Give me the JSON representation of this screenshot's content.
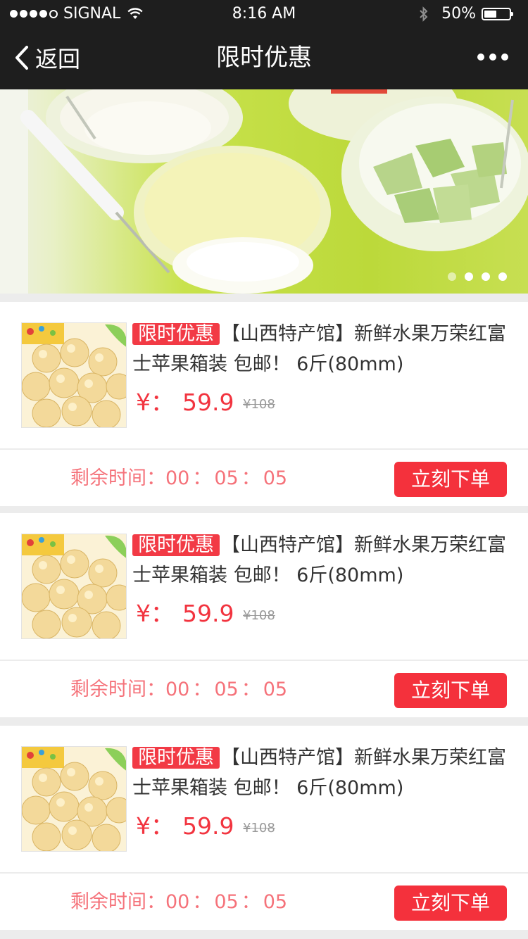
{
  "status_bar": {
    "carrier": "SIGNAL",
    "time": "8:16 AM",
    "battery_text": "50%",
    "battery_level": 0.5,
    "signal_bars": 4,
    "signal_bars_total": 5
  },
  "nav": {
    "back_label": "返回",
    "title": "限时优惠"
  },
  "banner": {
    "slide_count": 4,
    "active_index": 0
  },
  "products": [
    {
      "tag": "限时优惠",
      "title": "【山西特产馆】新鲜水果万荣红富士苹果箱装 包邮！ 6斤(80mm)",
      "currency": "¥：",
      "price": "59.9",
      "original_price": "¥108",
      "countdown_label": "剩余时间：",
      "countdown": [
        "00",
        "05",
        "05"
      ],
      "countdown_sep": "：",
      "order_label": "立刻下单"
    },
    {
      "tag": "限时优惠",
      "title": "【山西特产馆】新鲜水果万荣红富士苹果箱装 包邮！ 6斤(80mm)",
      "currency": "¥：",
      "price": "59.9",
      "original_price": "¥108",
      "countdown_label": "剩余时间：",
      "countdown": [
        "00",
        "05",
        "05"
      ],
      "countdown_sep": "：",
      "order_label": "立刻下单"
    },
    {
      "tag": "限时优惠",
      "title": "【山西特产馆】新鲜水果万荣红富士苹果箱装 包邮！ 6斤(80mm)",
      "currency": "¥：",
      "price": "59.9",
      "original_price": "¥108",
      "countdown_label": "剩余时间：",
      "countdown": [
        "00",
        "05",
        "05"
      ],
      "countdown_sep": "：",
      "order_label": "立刻下单"
    }
  ],
  "colors": {
    "nav_bg": "#1e1e1e",
    "accent_red": "#f4313c",
    "countdown_text": "#f5727a",
    "page_bg": "#ececec"
  }
}
